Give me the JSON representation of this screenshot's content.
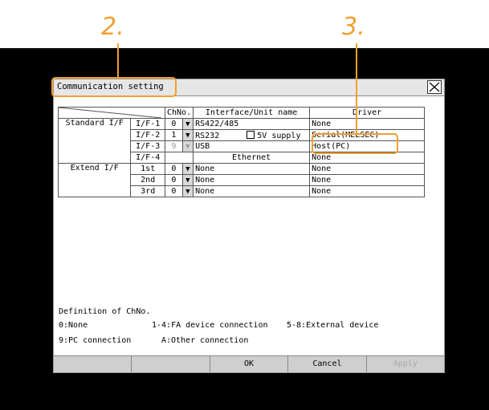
{
  "callouts": {
    "c2": "2.",
    "c3": "3."
  },
  "dialog": {
    "title": "Communication setting",
    "headers": {
      "chno": "ChNo.",
      "interface": "Interface/Unit name",
      "driver": "Driver"
    },
    "groups": {
      "standard": "Standard I/F",
      "extend": "Extend I/F"
    },
    "rows": [
      {
        "port": "I/F-1",
        "ch": "0",
        "arrow": "▼",
        "iface": "RS422/485",
        "driver": "None"
      },
      {
        "port": "I/F-2",
        "ch": "1",
        "arrow": "▼",
        "iface": "RS232",
        "supply": "5V supply",
        "driver": "Serial(MELSEC)"
      },
      {
        "port": "I/F-3",
        "ch": "9",
        "arrow": "▼",
        "iface": "USB",
        "driver": "Host(PC)"
      },
      {
        "port": "I/F-4",
        "ch": "",
        "arrow": "",
        "iface": "Ethernet",
        "driver": "None"
      },
      {
        "port": "1st",
        "ch": "0",
        "arrow": "▼",
        "iface": "None",
        "driver": "None"
      },
      {
        "port": "2nd",
        "ch": "0",
        "arrow": "▼",
        "iface": "None",
        "driver": "None"
      },
      {
        "port": "3rd",
        "ch": "0",
        "arrow": "▼",
        "iface": "None",
        "driver": "None"
      }
    ],
    "legend": {
      "heading": "Definition of ChNo.",
      "l1a": "0:None",
      "l1b": "1-4:FA device connection",
      "l1c": "5-8:External device",
      "l2a": "9:PC connection",
      "l2b": "A:Other connection"
    },
    "buttons": {
      "b1": "",
      "b2": "",
      "ok": "OK",
      "cancel": "Cancel",
      "apply": "Apply"
    }
  },
  "colors": {
    "highlight": "#f0a030"
  }
}
